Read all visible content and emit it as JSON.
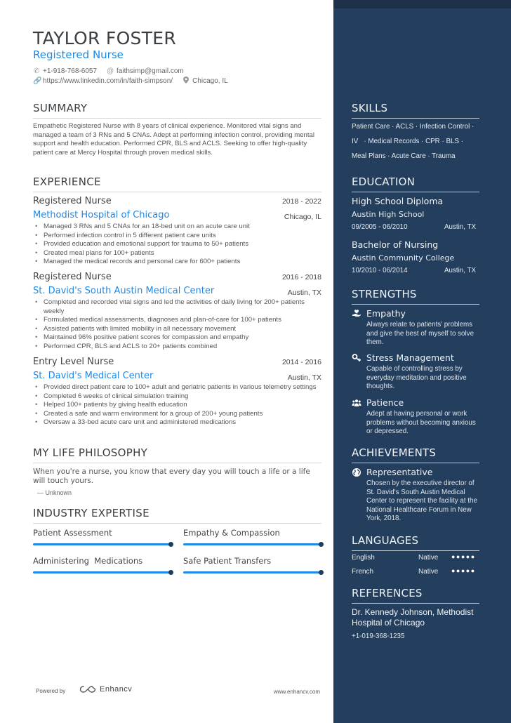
{
  "header": {
    "name": "TAYLOR FOSTER",
    "role": "Registered Nurse",
    "phone": "+1-918-768-6057",
    "email": "faithsimp@gmail.com",
    "linkedin": "https://www.linkedin.com/in/faith-simpson/",
    "location": "Chicago, IL"
  },
  "summary": {
    "title": "SUMMARY",
    "text": "Empathetic Registered Nurse with 8 years of clinical experience. Monitored vital signs and managed a team of 3 RNs and 5 CNAs. Adept at performing infection control, providing mental support and health education. Performed CPR, BLS and ACLS. Seeking to offer high-quality patient care at Mercy Hospital through proven medical skills."
  },
  "experience": {
    "title": "EXPERIENCE",
    "jobs": [
      {
        "title": "Registered Nurse",
        "dates": "2018 - 2022",
        "company": "Methodist Hospital of Chicago",
        "location": "Chicago, IL",
        "bullets": [
          "Managed 3 RNs and 5 CNAs for an 18-bed unit on an acute care unit",
          "Performed infection control in 5 different patient care units",
          "Provided education and emotional support for trauma to 50+ patients",
          "Created meal plans for 100+ patients",
          "Managed the medical records and personal care for 600+ patients"
        ]
      },
      {
        "title": "Registered Nurse",
        "dates": "2016 - 2018",
        "company": "St. David's South Austin Medical Center",
        "location": "Austin, TX",
        "bullets": [
          "Completed and recorded vital signs and led the activities of daily living for 200+ patients weekly",
          "Formulated medical assessments, diagnoses and plan-of-care for 100+ patients",
          "Assisted patients with limited mobility in all necessary movement",
          "Maintained 96% positive patient scores for compassion and empathy",
          "Performed CPR, BLS and ACLS to 20+ patients combined"
        ]
      },
      {
        "title": "Entry Level Nurse",
        "dates": "2014 - 2016",
        "company": "St. David's Medical Center",
        "location": "Austin, TX",
        "bullets": [
          "Provided direct patient care to 100+ adult and geriatric patients in various telemetry settings",
          "Completed 6 weeks of clinical simulation training",
          "Helped 100+ patients by giving health education",
          "Created a safe and warm environment for a group of 200+ young patients",
          "Oversaw a 33-bed acute care unit and administered medications"
        ]
      }
    ]
  },
  "philosophy": {
    "title": "MY LIFE PHILOSOPHY",
    "quote": "When you're a nurse, you know that every day you will touch a life or a life will touch yours.",
    "author": "— Unknown"
  },
  "expertise": {
    "title": "INDUSTRY EXPERTISE",
    "items": [
      {
        "label": "Patient Assessment",
        "level": 1.0
      },
      {
        "label": "Empathy & Compassion",
        "level": 1.0
      },
      {
        "label": "Administering  Medications",
        "level": 1.0
      },
      {
        "label": "Safe Patient Transfers",
        "level": 1.0
      }
    ],
    "fill_color": "#1e88e5"
  },
  "footer": {
    "powered_by": "Powered by",
    "brand": "Enhancv",
    "website": "www.enhancv.com"
  },
  "skills": {
    "title": "SKILLS",
    "lines": [
      "Patient Care · ACLS · Infection Control ·",
      "IV   · Medical Records · CPR · BLS ·",
      "Meal Plans · Acute Care · Trauma"
    ]
  },
  "education": {
    "title": "EDUCATION",
    "items": [
      {
        "degree": "High School Diploma",
        "school": "Austin High School",
        "dates": "09/2005 - 06/2010",
        "location": "Austin, TX"
      },
      {
        "degree": "Bachelor of Nursing",
        "school": "Austin Community College",
        "dates": "10/2010 - 06/2014",
        "location": "Austin, TX"
      }
    ]
  },
  "strengths": {
    "title": "STRENGTHS",
    "items": [
      {
        "icon": "hand-heart-icon",
        "title": "Empathy",
        "desc": "Always relate to patients' problems and give the best of myself to solve them."
      },
      {
        "icon": "key-icon",
        "title": "Stress Management",
        "desc": "Capable of controlling stress by everyday meditation and positive thoughts."
      },
      {
        "icon": "users-icon",
        "title": "Patience",
        "desc": "Adept at having personal or work problems without becoming anxious or depressed."
      }
    ]
  },
  "achievements": {
    "title": "ACHIEVEMENTS",
    "items": [
      {
        "icon": "globe-icon",
        "title": "Representative",
        "desc": "Chosen by the executive director of St. David's South Austin Medical Center to represent the facility at the National Healthcare Forum in New York, 2018."
      }
    ]
  },
  "languages": {
    "title": "LANGUAGES",
    "items": [
      {
        "name": "English",
        "level": "Native",
        "dots": "●●●●●",
        "rating": 5,
        "max": 5
      },
      {
        "name": "French",
        "level": "Native",
        "dots": "●●●●●",
        "rating": 5,
        "max": 5
      }
    ]
  },
  "references": {
    "title": "REFERENCES",
    "name": "Dr. Kennedy Johnson, Methodist Hospital of Chicago",
    "phone": "+1-019-368-1235"
  },
  "colors": {
    "accent": "#1e88e5",
    "sidebar": "#243f5d",
    "sidebar_top": "#1c3148",
    "heading": "#3b3f43"
  }
}
